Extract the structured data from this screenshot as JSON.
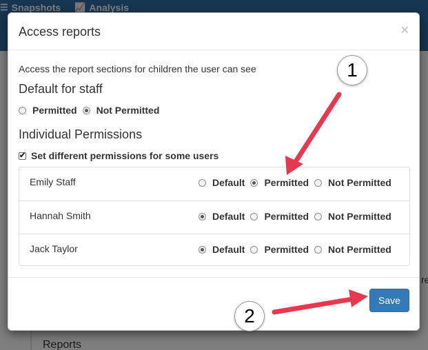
{
  "background": {
    "nav_items": [
      {
        "label": "Snapshots",
        "icon": "list-icon"
      },
      {
        "label": "Analysis",
        "icon": "chart-icon"
      }
    ],
    "sidebar_label": "Reports",
    "clipped_text": "re"
  },
  "modal": {
    "title": "Access reports",
    "close_glyph": "×",
    "intro": "Access the report sections for children the user can see",
    "default_heading": "Default for staff",
    "default_options": [
      {
        "label": "Permitted",
        "selected": false
      },
      {
        "label": "Not Permitted",
        "selected": true
      }
    ],
    "individual_heading": "Individual Permissions",
    "checkbox_label": "Set different permissions for some users",
    "checkbox_checked": true,
    "option_labels": {
      "default": "Default",
      "permitted": "Permitted",
      "not_permitted": "Not Permitted"
    },
    "users": [
      {
        "name": "Emily Staff",
        "selected": "permitted"
      },
      {
        "name": "Hannah Smith",
        "selected": "default"
      },
      {
        "name": "Jack Taylor",
        "selected": "default"
      }
    ],
    "save_label": "Save"
  },
  "annotations": {
    "callout_1": "1",
    "callout_2": "2",
    "arrow_color": "#e8384f"
  },
  "colors": {
    "navbar": "#2e6da4",
    "primary_button": "#337ab7"
  }
}
